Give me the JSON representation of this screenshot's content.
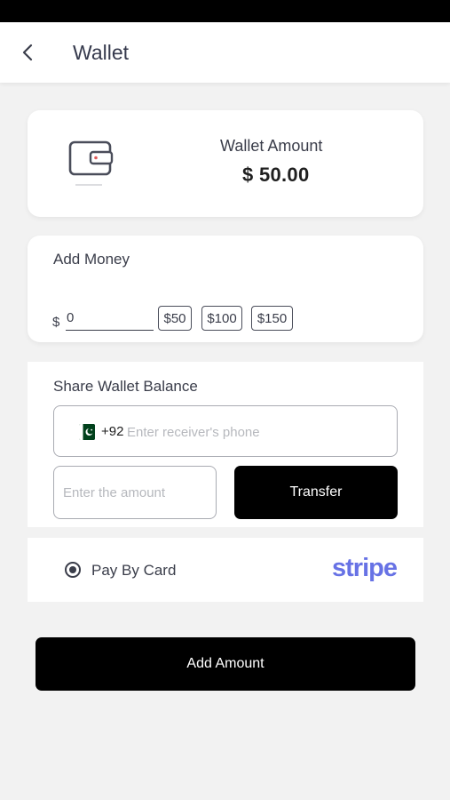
{
  "header": {
    "title": "Wallet",
    "back_icon": "chevron-left-icon"
  },
  "wallet": {
    "label": "Wallet Amount",
    "amount": "$ 50.00",
    "icon": "wallet-icon"
  },
  "add_money": {
    "title": "Add Money",
    "currency_symbol": "$",
    "input_value": "0",
    "presets": [
      "$50",
      "$100",
      "$150"
    ]
  },
  "share": {
    "title": "Share Wallet Balance",
    "country_flag": "pakistan-flag-icon",
    "dial_code": "+92",
    "phone_placeholder": "Enter receiver's phone",
    "amount_placeholder": "Enter the amount",
    "transfer_label": "Transfer"
  },
  "payment": {
    "option_label": "Pay By Card",
    "provider": "stripe",
    "selected": true
  },
  "footer": {
    "add_amount_label": "Add Amount"
  },
  "colors": {
    "primary": "#000000",
    "stripe": "#6772e5",
    "text": "#3a3d4a",
    "background": "#f2f2f2"
  }
}
